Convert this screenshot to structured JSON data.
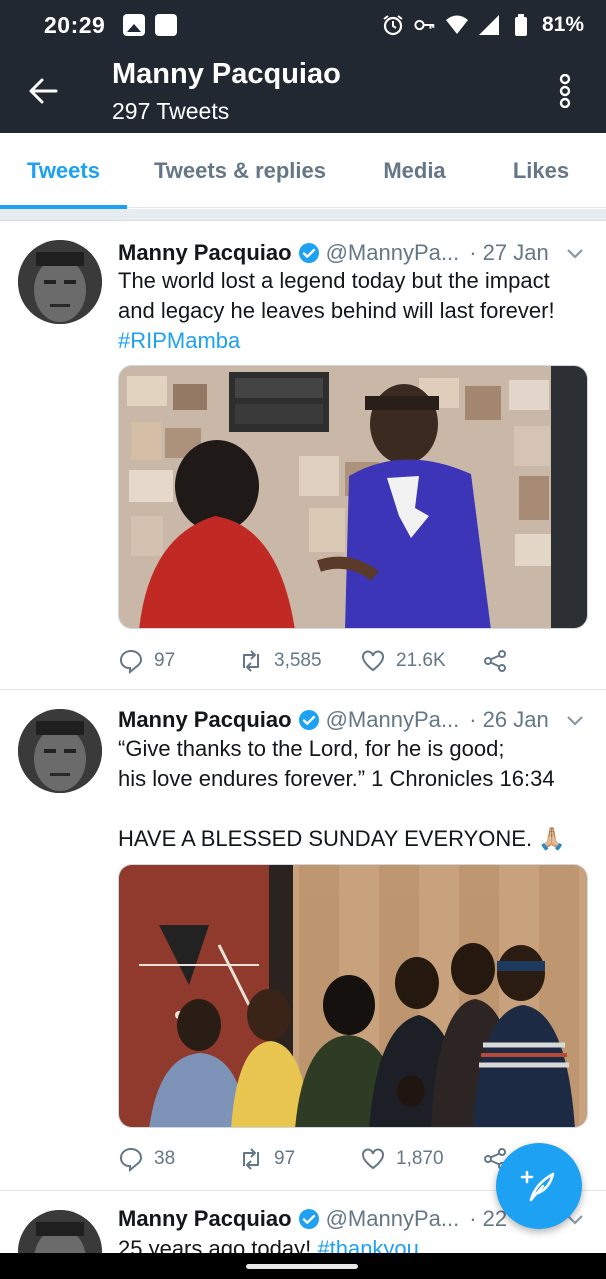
{
  "status_bar": {
    "time": "20:29",
    "battery": "81%",
    "icons": [
      "image-icon",
      "app-square-icon",
      "alarm-icon",
      "key-icon",
      "wifi-icon",
      "signal-icon",
      "battery-icon"
    ]
  },
  "header": {
    "title": "Manny Pacquiao",
    "subtitle": "297 Tweets"
  },
  "tabs": [
    {
      "label": "Tweets",
      "active": true
    },
    {
      "label": "Tweets & replies",
      "active": false
    },
    {
      "label": "Media",
      "active": false
    },
    {
      "label": "Likes",
      "active": false
    }
  ],
  "tweets": [
    {
      "name": "Manny Pacquiao",
      "handle": "@MannyPa...",
      "date": "· 27 Jan",
      "text": "The world lost a legend today but the impact and legacy he leaves behind will last forever!",
      "hashtag": "#RIPMamba",
      "replies": "97",
      "retweets": "3,585",
      "likes": "21.6K"
    },
    {
      "name": "Manny Pacquiao",
      "handle": "@MannyPa...",
      "date": "· 26 Jan",
      "text": "“Give thanks to the Lord, for he is good;\nhis love endures forever.” 1 Chronicles 16:34\n\nHAVE A BLESSED SUNDAY EVERYONE. 🙏🏼",
      "replies": "38",
      "retweets": "97",
      "likes": "1,870"
    },
    {
      "name": "Manny Pacquiao",
      "handle": "@MannyPa...",
      "date": "· 22",
      "text": "25 years ago today!",
      "hashtag": "#thankyou"
    }
  ],
  "colors": {
    "accent": "#1da1f2",
    "header_bg": "#222831",
    "secondary_text": "#657786"
  }
}
